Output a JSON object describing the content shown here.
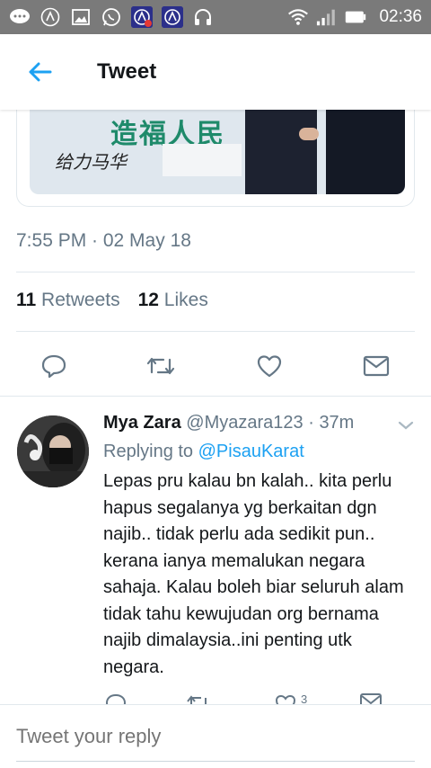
{
  "status_bar": {
    "time": "02:36",
    "icons": [
      "chat-bubble-icon",
      "headphones-logo-icon",
      "image-icon",
      "whatsapp-icon",
      "app-a-alert-icon",
      "app-a-icon",
      "headset-icon",
      "wifi-icon",
      "signal-icon",
      "battery-icon"
    ]
  },
  "app_bar": {
    "back_icon": "arrow-left-icon",
    "title": "Tweet"
  },
  "media": {
    "banner_text": "造福人民",
    "brand_text": "给力马华"
  },
  "tweet": {
    "timestamp": "7:55 PM · 02 May 18",
    "retweets_count": "11",
    "retweets_label": "Retweets",
    "likes_count": "12",
    "likes_label": "Likes"
  },
  "actions": [
    "reply-icon",
    "retweet-icon",
    "like-icon",
    "share-icon"
  ],
  "reply": {
    "name": "Mya Zara",
    "handle": "@Myazara123",
    "separator": " · ",
    "age": "37m",
    "replying_prefix": "Replying to ",
    "replying_to": "@PisauKarat",
    "body": "Lepas pru kalau bn kalah.. kita perlu hapus segalanya yg berkaitan dgn najib.. tidak perlu ada sedikit pun.. kerana ianya memalukan negara sahaja. Kalau boleh biar seluruh alam tidak tahu kewujudan org bernama najib dimalaysia..ini penting utk negara.",
    "likes": "3"
  },
  "composer": {
    "placeholder": "Tweet your reply"
  },
  "colors": {
    "accent": "#1da1f2",
    "secondary_text": "#657786",
    "primary_text": "#14171a",
    "status_bar": "#7a7a7a"
  }
}
